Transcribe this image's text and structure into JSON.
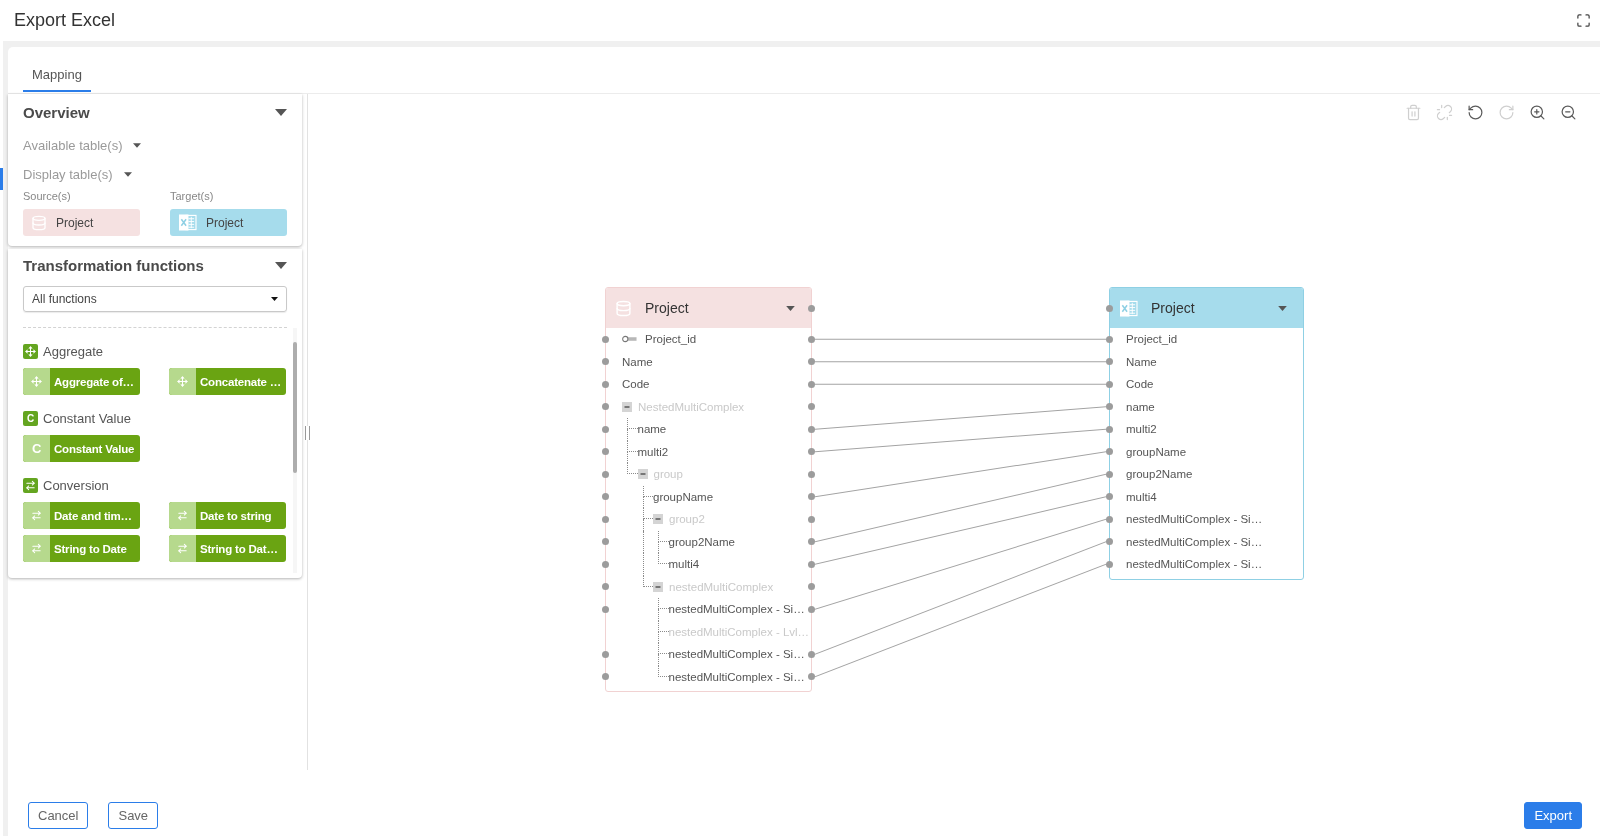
{
  "window": {
    "title": "Export Excel"
  },
  "tabs": [
    {
      "label": "Mapping",
      "selected": true
    }
  ],
  "overview": {
    "title": "Overview",
    "expanded": true,
    "dropdowns": [
      {
        "label": "Available table(s)"
      },
      {
        "label": "Display table(s)"
      }
    ],
    "sources_label": "Source(s)",
    "targets_label": "Target(s)",
    "sources": [
      {
        "name": "Project"
      }
    ],
    "targets": [
      {
        "name": "Project"
      }
    ]
  },
  "transformation_functions": {
    "title": "Transformation functions",
    "expanded": true,
    "filter": {
      "value": "All functions"
    },
    "groups": [
      {
        "kind": "aggregate",
        "name": "Aggregate",
        "functions": [
          {
            "label": "Aggregate of…"
          },
          {
            "label": "Concatenate …"
          }
        ]
      },
      {
        "kind": "constant",
        "symbol": "C",
        "name": "Constant Value",
        "functions": [
          {
            "label": "Constant Value",
            "symbol": "C"
          }
        ]
      },
      {
        "kind": "conversion",
        "name": "Conversion",
        "functions": [
          {
            "label": "Date and tim…"
          },
          {
            "label": "Date to string"
          },
          {
            "label": "String to Date"
          },
          {
            "label": "String to Dat…"
          }
        ]
      }
    ]
  },
  "toolbar": [
    {
      "kind": "delete",
      "disabled": true
    },
    {
      "kind": "unlink",
      "disabled": true
    },
    {
      "kind": "undo",
      "disabled": false
    },
    {
      "kind": "redo",
      "disabled": true
    },
    {
      "kind": "zoom_in",
      "disabled": false
    },
    {
      "kind": "zoom_out",
      "disabled": false
    }
  ],
  "source_table": {
    "title": "Project",
    "fields": [
      {
        "name": "Project_id",
        "kind": "key",
        "mapped": true,
        "disabled": false
      },
      {
        "name": "Name",
        "kind": "field",
        "mapped": true,
        "disabled": false
      },
      {
        "name": "Code",
        "kind": "field",
        "mapped": true,
        "disabled": false
      },
      {
        "name": "NestedMultiComplex",
        "kind": "group",
        "expanded": true,
        "mapped": false,
        "disabled": false,
        "children": [
          {
            "name": "name",
            "kind": "field",
            "mapped": true,
            "disabled": false
          },
          {
            "name": "multi2",
            "kind": "field",
            "mapped": true,
            "disabled": false
          },
          {
            "name": "group",
            "kind": "group",
            "expanded": true,
            "mapped": false,
            "disabled": false,
            "children": [
              {
                "name": "groupName",
                "kind": "field",
                "mapped": true,
                "disabled": false
              },
              {
                "name": "group2",
                "kind": "group",
                "expanded": true,
                "mapped": false,
                "disabled": false,
                "children": [
                  {
                    "name": "group2Name",
                    "kind": "field",
                    "mapped": true,
                    "disabled": false
                  },
                  {
                    "name": "multi4",
                    "kind": "field",
                    "mapped": true,
                    "disabled": false
                  }
                ]
              },
              {
                "name": "nestedMultiComplex",
                "kind": "group",
                "expanded": true,
                "mapped": false,
                "disabled": false,
                "children": [
                  {
                    "name": "nestedMultiComplex - Si…",
                    "kind": "field",
                    "mapped": true,
                    "disabled": false
                  },
                  {
                    "name": "nestedMultiComplex - Lvl…",
                    "kind": "field",
                    "mapped": false,
                    "disabled": true
                  },
                  {
                    "name": "nestedMultiComplex - Si…",
                    "kind": "field",
                    "mapped": true,
                    "disabled": false
                  },
                  {
                    "name": "nestedMultiComplex - Si…",
                    "kind": "field",
                    "mapped": true,
                    "disabled": false
                  }
                ]
              }
            ]
          }
        ]
      }
    ]
  },
  "target_table": {
    "title": "Project",
    "fields": [
      {
        "name": "Project_id",
        "mapped": true
      },
      {
        "name": "Name",
        "mapped": true
      },
      {
        "name": "Code",
        "mapped": true
      },
      {
        "name": "name",
        "mapped": true
      },
      {
        "name": "multi2",
        "mapped": true
      },
      {
        "name": "groupName",
        "mapped": true
      },
      {
        "name": "group2Name",
        "mapped": true
      },
      {
        "name": "multi4",
        "mapped": true
      },
      {
        "name": "nestedMultiComplex - Si…",
        "mapped": true
      },
      {
        "name": "nestedMultiComplex - Si…",
        "mapped": true
      },
      {
        "name": "nestedMultiComplex - Si…",
        "mapped": true
      }
    ]
  },
  "buttons": [
    {
      "label": "Cancel",
      "kind": "secondary"
    },
    {
      "label": "Save",
      "kind": "secondary"
    },
    {
      "label": "Export",
      "kind": "primary"
    }
  ]
}
